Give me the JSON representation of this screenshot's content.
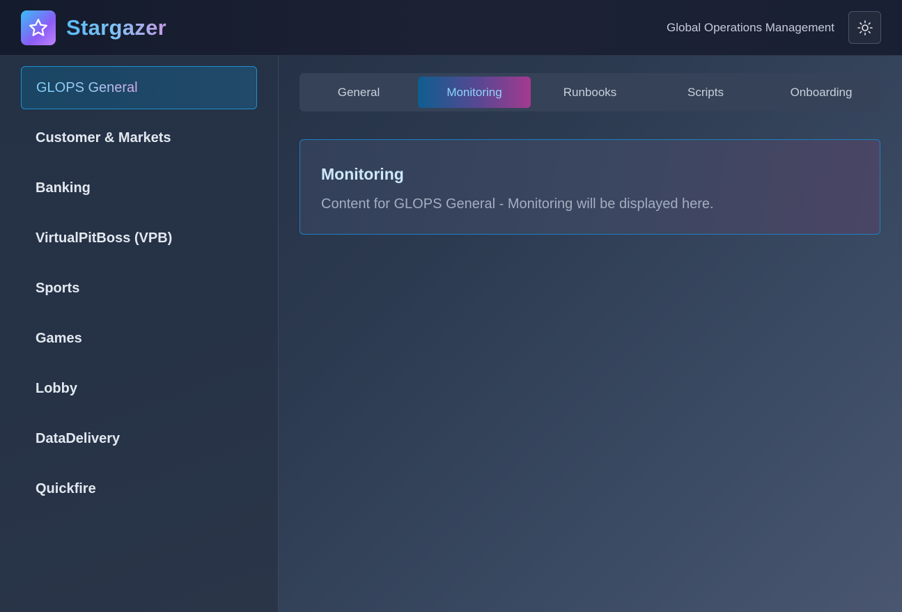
{
  "header": {
    "brand": "Stargazer",
    "org_label": "Global Operations Management",
    "logo_icon": "star-icon",
    "theme_icon": "sun-icon"
  },
  "sidebar": {
    "items": [
      {
        "label": "GLOPS General",
        "active": true
      },
      {
        "label": "Customer & Markets",
        "active": false
      },
      {
        "label": "Banking",
        "active": false
      },
      {
        "label": "VirtualPitBoss (VPB)",
        "active": false
      },
      {
        "label": "Sports",
        "active": false
      },
      {
        "label": "Games",
        "active": false
      },
      {
        "label": "Lobby",
        "active": false
      },
      {
        "label": "DataDelivery",
        "active": false
      },
      {
        "label": "Quickfire",
        "active": false
      }
    ]
  },
  "tabs": [
    {
      "label": "General",
      "active": false
    },
    {
      "label": "Monitoring",
      "active": true
    },
    {
      "label": "Runbooks",
      "active": false
    },
    {
      "label": "Scripts",
      "active": false
    },
    {
      "label": "Onboarding",
      "active": false
    }
  ],
  "content": {
    "title": "Monitoring",
    "body": "Content for GLOPS General - Monitoring will be displayed here."
  },
  "colors": {
    "accent": "#38bdf8",
    "accent_secondary": "#c084fc",
    "header_bg": "#161d2e",
    "sidebar_bg": "#263246"
  }
}
